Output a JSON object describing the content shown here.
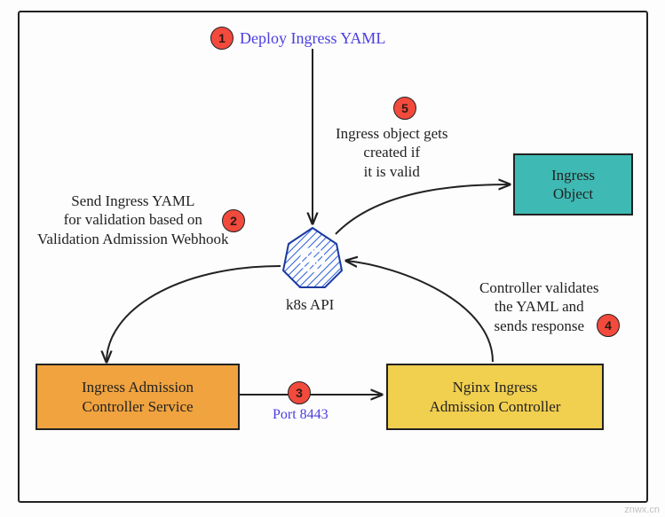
{
  "step1": {
    "num": "1",
    "label": "Deploy Ingress YAML"
  },
  "step2": {
    "num": "2",
    "label": "Send Ingress YAML\nfor validation based on\nValidation Admission Webhook"
  },
  "step3": {
    "num": "3",
    "label": "Port 8443"
  },
  "step4": {
    "num": "4",
    "label": "Controller validates\nthe YAML and\nsends response"
  },
  "step5": {
    "num": "5",
    "label": "Ingress object gets\ncreated if\nit is valid"
  },
  "api": {
    "label": "k8s API"
  },
  "nodes": {
    "admissionService": "Ingress Admission\nController Service",
    "nginxController": "Nginx Ingress\nAdmission Controller",
    "ingressObject": "Ingress\nObject"
  },
  "watermark": "znwx.cn"
}
